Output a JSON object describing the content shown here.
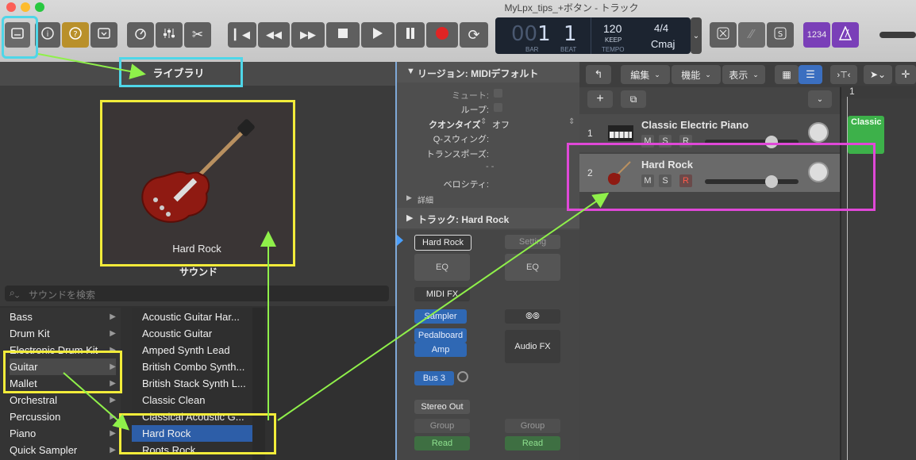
{
  "window": {
    "title": "MyLpx_tips_+ボタン - トラック"
  },
  "lcd": {
    "bar": "001",
    "beat": "1",
    "bar_label": "BAR",
    "beat_label": "BEAT",
    "tempo": "120",
    "tempo_label": "TEMPO",
    "keep": "KEEP",
    "sig": "4/4",
    "key": "Cmaj"
  },
  "toolbar": {
    "count_in": "1234"
  },
  "library": {
    "title": "ライブラリ",
    "preview_name": "Hard Rock",
    "sound_label": "サウンド",
    "search_placeholder": "サウンドを検索",
    "categories": [
      "Bass",
      "Drum Kit",
      "Electronic Drum Kit",
      "Guitar",
      "Mallet",
      "Orchestral",
      "Percussion",
      "Piano",
      "Quick Sampler"
    ],
    "patches": [
      "Acoustic Guitar Har...",
      "Acoustic Guitar",
      "Amped Synth Lead",
      "British Combo Synth...",
      "British Stack Synth L...",
      "Classic Clean",
      "Classical Acoustic G...",
      "Hard Rock",
      "Roots Rock"
    ]
  },
  "inspector": {
    "region_title": "リージョン: MIDIデフォルト",
    "mute": "ミュート:",
    "loop": "ループ:",
    "quantize": "クオンタイズ",
    "quantize_value": "オフ",
    "qswing": "Q-スウィング:",
    "transpose": "トランスポーズ:",
    "dashes": "- -",
    "velocity": "ベロシティ:",
    "detail": "詳細",
    "track_title": "トラック: Hard Rock",
    "strip1": {
      "name": "Hard Rock",
      "eq": "EQ",
      "midifx": "MIDI FX",
      "sampler": "Sampler",
      "pedalboard": "Pedalboard",
      "amp": "Amp",
      "bus": "Bus 3",
      "out": "Stereo Out",
      "group": "Group",
      "read": "Read"
    },
    "strip2": {
      "setting": "Setting",
      "eq": "EQ",
      "audiofx": "Audio FX",
      "group": "Group",
      "read": "Read"
    }
  },
  "tracks_header": {
    "edit": "編集",
    "functions": "機能",
    "view": "表示"
  },
  "tracks": [
    {
      "num": "1",
      "name": "Classic Electric Piano",
      "m": "M",
      "s": "S",
      "r": "R"
    },
    {
      "num": "2",
      "name": "Hard Rock",
      "m": "M",
      "s": "S",
      "r": "R"
    }
  ],
  "ruler": {
    "bar1": "1"
  },
  "region": {
    "label": "Classic"
  },
  "colors": {
    "annot_cyan": "#4fd6e8",
    "annot_yellow": "#f2ec3a",
    "annot_magenta": "#e048d8",
    "annot_arrow": "#8ff04a",
    "region_green": "#3db14a",
    "selected_row": "#2d5ea8"
  }
}
